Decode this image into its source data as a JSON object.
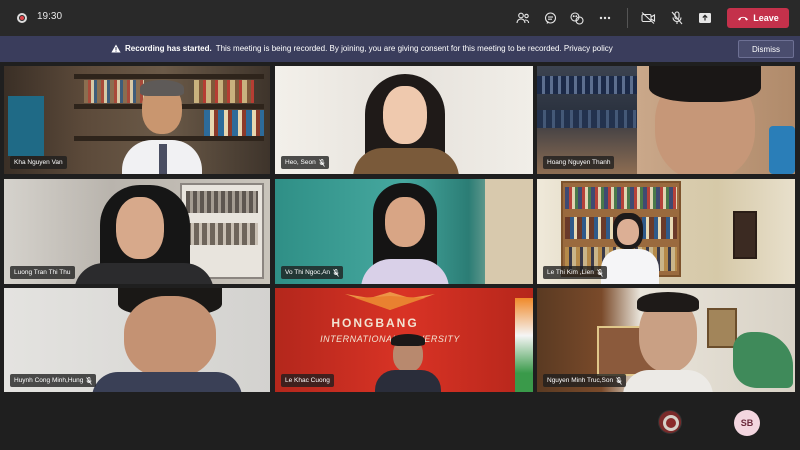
{
  "topbar": {
    "timer": "19:30",
    "leave_label": "Leave",
    "icons": [
      "participants-icon",
      "chat-icon",
      "reactions-icon",
      "more-icon",
      "camera-off-icon",
      "mic-off-icon",
      "share-icon",
      "phone-icon"
    ]
  },
  "banner": {
    "title": "Recording has started.",
    "message": "This meeting is being recorded. By joining, you are giving consent for this meeting to be recorded. Privacy policy",
    "dismiss_label": "Dismiss"
  },
  "participants": [
    {
      "name": "Kha Nguyen Van",
      "muted": false
    },
    {
      "name": "Heo, Seon",
      "muted": true
    },
    {
      "name": "Hoang Nguyen Thanh",
      "muted": false
    },
    {
      "name": "Luong Tran Thi Thu",
      "muted": false
    },
    {
      "name": "Vo Thi Ngoc,An",
      "muted": true
    },
    {
      "name": "Le Thi Kim ,Lien",
      "muted": true
    },
    {
      "name": "Huynh Cong Minh,Hung",
      "muted": true
    },
    {
      "name": "Le Khac Cuong",
      "muted": false
    },
    {
      "name": "Nguyen Minh Truc,Son",
      "muted": true
    }
  ],
  "tile8_sign": {
    "line1": "HONGBANG",
    "line2": "INTERNATIONAL UNIVERSITY"
  },
  "bottom": {
    "avatar_initials": "SB"
  },
  "colors": {
    "leave": "#c4314b",
    "banner": "#3a3d5c",
    "avatar_bg": "#f3d6df"
  }
}
